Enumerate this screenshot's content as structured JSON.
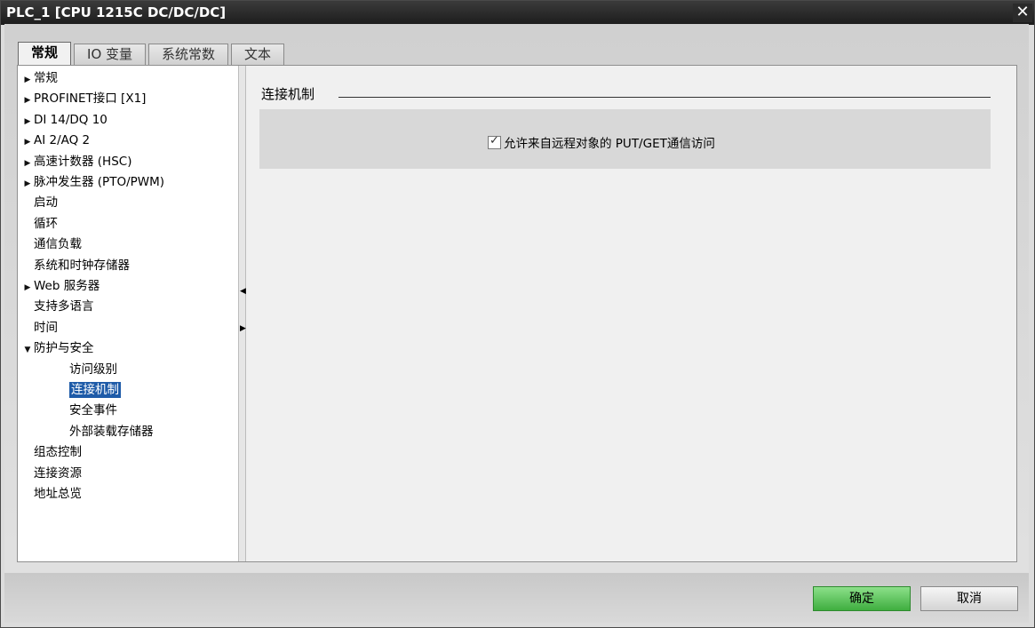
{
  "window": {
    "title": "PLC_1 [CPU 1215C DC/DC/DC]",
    "close_glyph": "✕"
  },
  "tabs": [
    {
      "label": "常规",
      "active": true
    },
    {
      "label": "IO 变量",
      "active": false
    },
    {
      "label": "系统常数",
      "active": false
    },
    {
      "label": "文本",
      "active": false
    }
  ],
  "nav": {
    "items": [
      {
        "label": "常规",
        "arrow": "▶",
        "indent": 0
      },
      {
        "label": "PROFINET接口 [X1]",
        "arrow": "▶",
        "indent": 0
      },
      {
        "label": "DI 14/DQ 10",
        "arrow": "▶",
        "indent": 0
      },
      {
        "label": "AI 2/AQ 2",
        "arrow": "▶",
        "indent": 0
      },
      {
        "label": "高速计数器 (HSC)",
        "arrow": "▶",
        "indent": 0
      },
      {
        "label": "脉冲发生器 (PTO/PWM)",
        "arrow": "▶",
        "indent": 0
      },
      {
        "label": "启动",
        "arrow": "",
        "indent": 0
      },
      {
        "label": "循环",
        "arrow": "",
        "indent": 0
      },
      {
        "label": "通信负载",
        "arrow": "",
        "indent": 0
      },
      {
        "label": "系统和时钟存储器",
        "arrow": "",
        "indent": 0
      },
      {
        "label": "Web 服务器",
        "arrow": "▶",
        "indent": 0
      },
      {
        "label": "支持多语言",
        "arrow": "",
        "indent": 0
      },
      {
        "label": "时间",
        "arrow": "",
        "indent": 0
      },
      {
        "label": "防护与安全",
        "arrow": "▼",
        "indent": 0
      },
      {
        "label": "访问级别",
        "arrow": "",
        "indent": 1
      },
      {
        "label": "连接机制",
        "arrow": "",
        "indent": 1,
        "selected": true
      },
      {
        "label": "安全事件",
        "arrow": "",
        "indent": 1
      },
      {
        "label": "外部装载存储器",
        "arrow": "",
        "indent": 1
      },
      {
        "label": "组态控制",
        "arrow": "",
        "indent": 0
      },
      {
        "label": "连接资源",
        "arrow": "",
        "indent": 0
      },
      {
        "label": "地址总览",
        "arrow": "",
        "indent": 0
      }
    ]
  },
  "main": {
    "section_title": "连接机制",
    "checkbox_label": "允许来自远程对象的 PUT/GET通信访问",
    "checkbox_checked": true
  },
  "buttons": {
    "ok": "确定",
    "cancel": "取消"
  },
  "colors": {
    "selection": "#1e5ba8",
    "ok_button": "#3fae3f"
  }
}
